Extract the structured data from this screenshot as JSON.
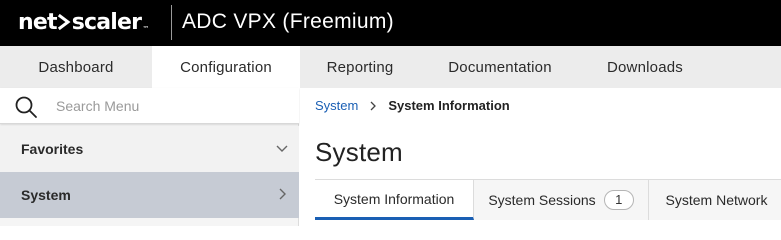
{
  "header": {
    "brand_left": "net",
    "brand_right": "scaler",
    "brand_tm": "™",
    "product_title": "ADC VPX (Freemium)"
  },
  "main_nav": {
    "tabs": [
      {
        "label": "Dashboard",
        "active": false
      },
      {
        "label": "Configuration",
        "active": true
      },
      {
        "label": "Reporting",
        "active": false
      },
      {
        "label": "Documentation",
        "active": false
      },
      {
        "label": "Downloads",
        "active": false
      }
    ]
  },
  "sidebar": {
    "search": {
      "placeholder": "Search Menu",
      "value": ""
    },
    "items": [
      {
        "label": "Favorites",
        "icon": "chevron-down-icon"
      },
      {
        "label": "System",
        "icon": "chevron-right-icon",
        "selected": true
      }
    ]
  },
  "breadcrumb": {
    "parent": "System",
    "current": "System Information"
  },
  "page": {
    "title": "System"
  },
  "sub_tabs": [
    {
      "label": "System Information",
      "active": true
    },
    {
      "label": "System Sessions",
      "badge": "1"
    },
    {
      "label": "System Network"
    }
  ],
  "colors": {
    "header_bg": "#000000",
    "nav_bg": "#ececec",
    "selected_sidebar_bg": "#c6cbd4",
    "link": "#1a5fb4",
    "brand_accent": "#ffffff"
  }
}
